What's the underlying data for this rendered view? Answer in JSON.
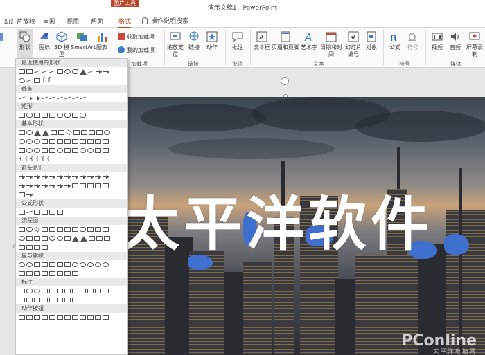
{
  "titlebar": {
    "context_tab_group": "图片工具",
    "document_title": "演示文稿1 - PowerPoint"
  },
  "tabs": [
    {
      "label": "幻灯片放映"
    },
    {
      "label": "审阅"
    },
    {
      "label": "视图"
    },
    {
      "label": "帮助"
    },
    {
      "label": "格式"
    }
  ],
  "tell_me": "操作说明搜索",
  "ribbon": {
    "shapes": "形状",
    "icons": "图标",
    "model3d": "3D 模型",
    "smartart": "SmartArt",
    "chart": "图表",
    "get_addins": "获取加载项",
    "my_addins": "我的加载项",
    "addins_group": "加载项",
    "zoom": "缩放定位",
    "link": "链接",
    "action": "动作",
    "links_group": "链接",
    "comment": "批注",
    "comments_group": "批注",
    "textbox": "文本框",
    "header_footer": "页眉和页脚",
    "wordart": "艺术字",
    "datetime": "日期和时间",
    "slide_number": "幻灯片编号",
    "object": "对象",
    "text_group": "文本",
    "equation": "公式",
    "symbol": "符号",
    "symbols_group": "符号",
    "video": "视频",
    "audio": "音频",
    "screen_record": "屏幕录制",
    "media_group": "媒体"
  },
  "shapes_panel": {
    "categories": [
      "最近使用的形状",
      "线条",
      "矩形",
      "基本形状",
      "箭头总汇",
      "公式形状",
      "流程图",
      "星与旗帜",
      "标注",
      "动作按钮"
    ]
  },
  "slide": {
    "headline": "太平洋软件",
    "watermark": "PConline",
    "watermark_sub": "太 平 洋 电 脑 网"
  },
  "colors": {
    "accent": "#b7472a",
    "blob": "#3f6fcf"
  }
}
